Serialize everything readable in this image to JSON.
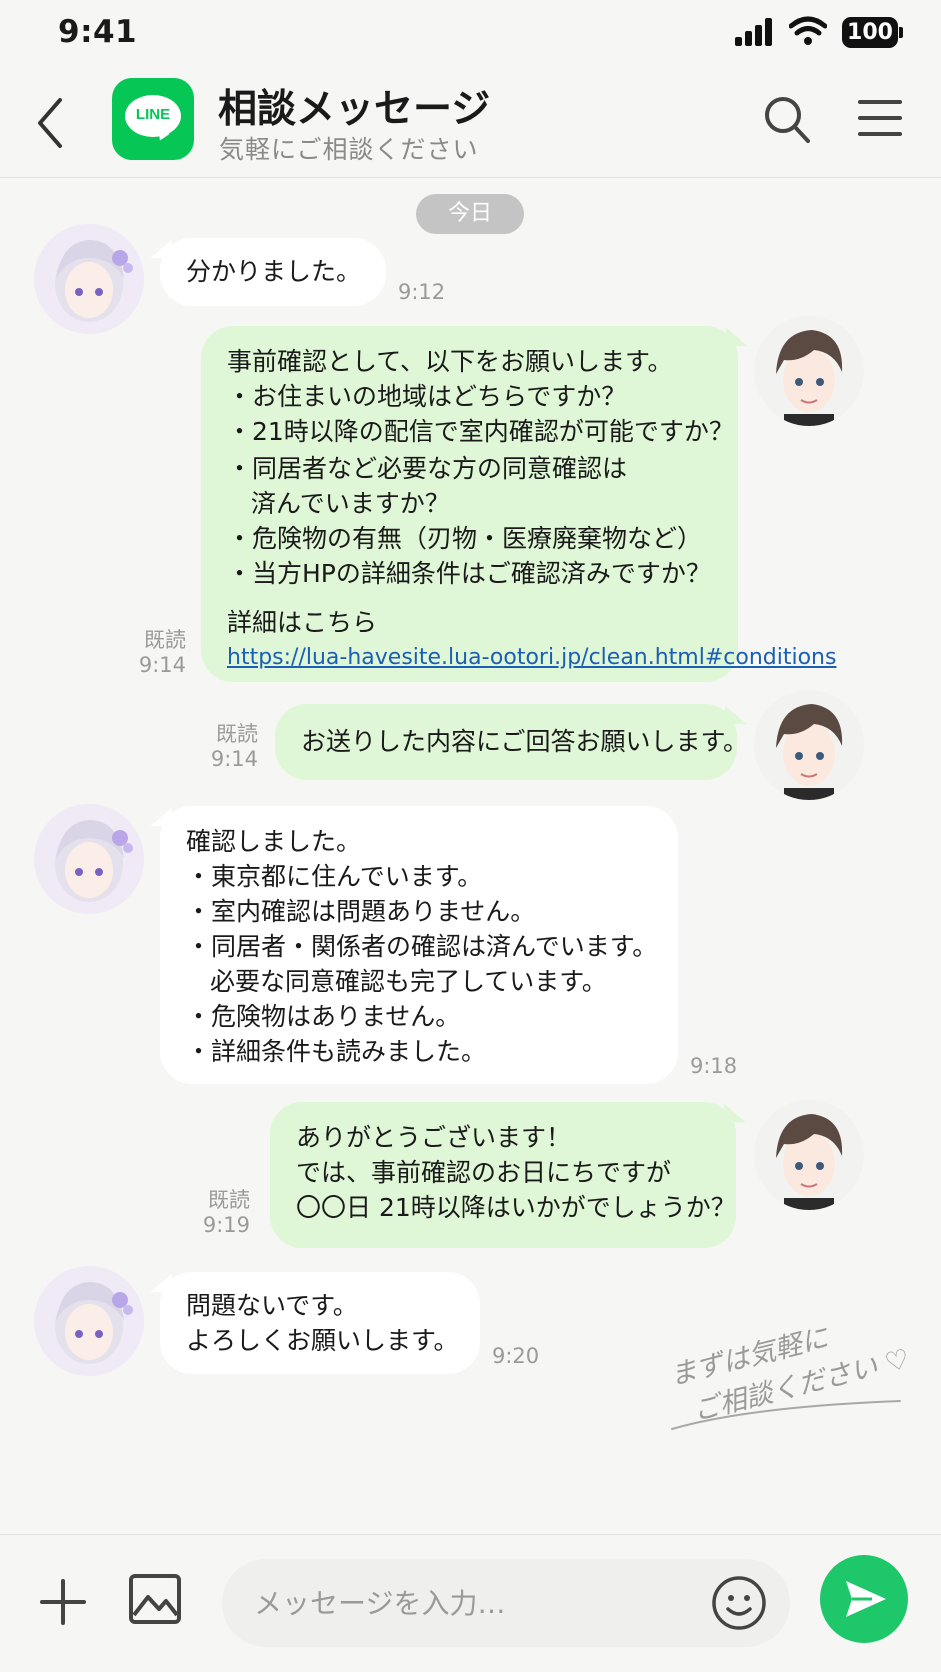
{
  "status_bar": {
    "time": "9:41",
    "battery": "100"
  },
  "header": {
    "logo_text": "LINE",
    "title": "相談メッセージ",
    "subtitle": "気軽にご相談ください"
  },
  "chat": {
    "date_label": "今日",
    "messages": [
      {
        "from": "them",
        "lines": [
          "分かりました。"
        ],
        "time": "9:12"
      },
      {
        "from": "me",
        "lines": [
          "事前確認として、以下をお願いします。",
          "・お住まいの地域はどちらですか？",
          "・21時以降の配信で室内確認が可能ですか？",
          "・同居者など必要な方の同意確認は",
          "済んでいますか？",
          "・危険物の有無（刃物・医療廃棄物など）",
          "・当方HPの詳細条件はご確認済みですか？",
          "詳細はこちら"
        ],
        "link": "https://lua-havesite.lua-ootori.jp/clean.html#conditions",
        "read": "既読",
        "time": "9:14"
      },
      {
        "from": "me",
        "lines": [
          "お送りした内容にご回答お願いします。"
        ],
        "read": "既読",
        "time": "9:14"
      },
      {
        "from": "them",
        "lines": [
          "確認しました。",
          "・東京都に住んでいます。",
          "・室内確認は問題ありません。",
          "・同居者・関係者の確認は済んでいます。",
          "必要な同意確認も完了しています。",
          "・危険物はありません。",
          "・詳細条件も読みました。"
        ],
        "time": "9:18"
      },
      {
        "from": "me",
        "lines": [
          "ありがとうございます！",
          "では、事前確認のお日にちですが",
          "〇〇日 21時以降はいかがでしょうか？"
        ],
        "read": "既読",
        "time": "9:19"
      },
      {
        "from": "them",
        "lines": [
          "問題ないです。",
          "よろしくお願いします。"
        ],
        "time": "9:20"
      }
    ],
    "handwriting": [
      "まずは気軽に",
      "ご相談ください ♡"
    ]
  },
  "input_bar": {
    "placeholder": "メッセージを入力…"
  },
  "colors": {
    "line_green": "#06c755",
    "send_green": "#1dc76a",
    "outgoing_bubble": "#dff7d6",
    "incoming_bubble": "#ffffff",
    "link": "#1a5fb4"
  },
  "icons": [
    "back-icon",
    "search-icon",
    "menu-icon",
    "plus-icon",
    "image-icon",
    "emoji-icon",
    "send-icon"
  ]
}
